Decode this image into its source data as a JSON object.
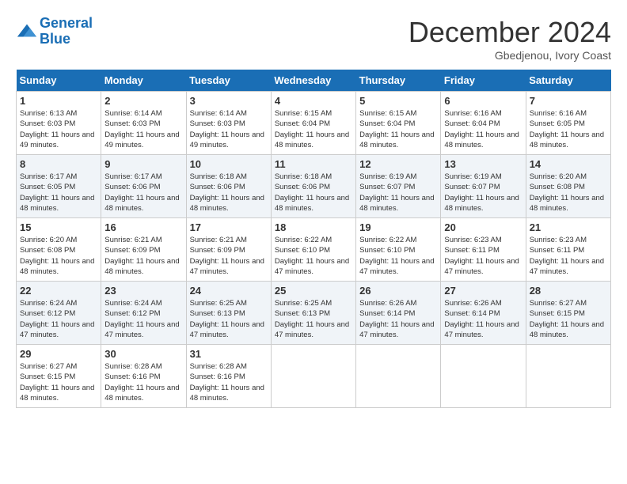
{
  "header": {
    "logo_line1": "General",
    "logo_line2": "Blue",
    "month_title": "December 2024",
    "location": "Gbedjenou, Ivory Coast"
  },
  "weekdays": [
    "Sunday",
    "Monday",
    "Tuesday",
    "Wednesday",
    "Thursday",
    "Friday",
    "Saturday"
  ],
  "weeks": [
    [
      {
        "day": "1",
        "sunrise": "6:13 AM",
        "sunset": "6:03 PM",
        "daylight": "11 hours and 49 minutes."
      },
      {
        "day": "2",
        "sunrise": "6:14 AM",
        "sunset": "6:03 PM",
        "daylight": "11 hours and 49 minutes."
      },
      {
        "day": "3",
        "sunrise": "6:14 AM",
        "sunset": "6:03 PM",
        "daylight": "11 hours and 49 minutes."
      },
      {
        "day": "4",
        "sunrise": "6:15 AM",
        "sunset": "6:04 PM",
        "daylight": "11 hours and 48 minutes."
      },
      {
        "day": "5",
        "sunrise": "6:15 AM",
        "sunset": "6:04 PM",
        "daylight": "11 hours and 48 minutes."
      },
      {
        "day": "6",
        "sunrise": "6:16 AM",
        "sunset": "6:04 PM",
        "daylight": "11 hours and 48 minutes."
      },
      {
        "day": "7",
        "sunrise": "6:16 AM",
        "sunset": "6:05 PM",
        "daylight": "11 hours and 48 minutes."
      }
    ],
    [
      {
        "day": "8",
        "sunrise": "6:17 AM",
        "sunset": "6:05 PM",
        "daylight": "11 hours and 48 minutes."
      },
      {
        "day": "9",
        "sunrise": "6:17 AM",
        "sunset": "6:06 PM",
        "daylight": "11 hours and 48 minutes."
      },
      {
        "day": "10",
        "sunrise": "6:18 AM",
        "sunset": "6:06 PM",
        "daylight": "11 hours and 48 minutes."
      },
      {
        "day": "11",
        "sunrise": "6:18 AM",
        "sunset": "6:06 PM",
        "daylight": "11 hours and 48 minutes."
      },
      {
        "day": "12",
        "sunrise": "6:19 AM",
        "sunset": "6:07 PM",
        "daylight": "11 hours and 48 minutes."
      },
      {
        "day": "13",
        "sunrise": "6:19 AM",
        "sunset": "6:07 PM",
        "daylight": "11 hours and 48 minutes."
      },
      {
        "day": "14",
        "sunrise": "6:20 AM",
        "sunset": "6:08 PM",
        "daylight": "11 hours and 48 minutes."
      }
    ],
    [
      {
        "day": "15",
        "sunrise": "6:20 AM",
        "sunset": "6:08 PM",
        "daylight": "11 hours and 48 minutes."
      },
      {
        "day": "16",
        "sunrise": "6:21 AM",
        "sunset": "6:09 PM",
        "daylight": "11 hours and 48 minutes."
      },
      {
        "day": "17",
        "sunrise": "6:21 AM",
        "sunset": "6:09 PM",
        "daylight": "11 hours and 47 minutes."
      },
      {
        "day": "18",
        "sunrise": "6:22 AM",
        "sunset": "6:10 PM",
        "daylight": "11 hours and 47 minutes."
      },
      {
        "day": "19",
        "sunrise": "6:22 AM",
        "sunset": "6:10 PM",
        "daylight": "11 hours and 47 minutes."
      },
      {
        "day": "20",
        "sunrise": "6:23 AM",
        "sunset": "6:11 PM",
        "daylight": "11 hours and 47 minutes."
      },
      {
        "day": "21",
        "sunrise": "6:23 AM",
        "sunset": "6:11 PM",
        "daylight": "11 hours and 47 minutes."
      }
    ],
    [
      {
        "day": "22",
        "sunrise": "6:24 AM",
        "sunset": "6:12 PM",
        "daylight": "11 hours and 47 minutes."
      },
      {
        "day": "23",
        "sunrise": "6:24 AM",
        "sunset": "6:12 PM",
        "daylight": "11 hours and 47 minutes."
      },
      {
        "day": "24",
        "sunrise": "6:25 AM",
        "sunset": "6:13 PM",
        "daylight": "11 hours and 47 minutes."
      },
      {
        "day": "25",
        "sunrise": "6:25 AM",
        "sunset": "6:13 PM",
        "daylight": "11 hours and 47 minutes."
      },
      {
        "day": "26",
        "sunrise": "6:26 AM",
        "sunset": "6:14 PM",
        "daylight": "11 hours and 47 minutes."
      },
      {
        "day": "27",
        "sunrise": "6:26 AM",
        "sunset": "6:14 PM",
        "daylight": "11 hours and 47 minutes."
      },
      {
        "day": "28",
        "sunrise": "6:27 AM",
        "sunset": "6:15 PM",
        "daylight": "11 hours and 48 minutes."
      }
    ],
    [
      {
        "day": "29",
        "sunrise": "6:27 AM",
        "sunset": "6:15 PM",
        "daylight": "11 hours and 48 minutes."
      },
      {
        "day": "30",
        "sunrise": "6:28 AM",
        "sunset": "6:16 PM",
        "daylight": "11 hours and 48 minutes."
      },
      {
        "day": "31",
        "sunrise": "6:28 AM",
        "sunset": "6:16 PM",
        "daylight": "11 hours and 48 minutes."
      },
      null,
      null,
      null,
      null
    ]
  ],
  "labels": {
    "sunrise": "Sunrise: ",
    "sunset": "Sunset: ",
    "daylight": "Daylight: "
  }
}
